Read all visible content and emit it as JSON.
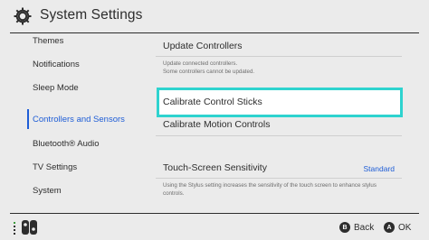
{
  "header": {
    "title": "System Settings",
    "icon": "gear-icon"
  },
  "sidebar": {
    "items": [
      {
        "label": "Themes"
      },
      {
        "label": "Notifications"
      },
      {
        "label": "Sleep Mode"
      },
      {
        "label": "Controllers and Sensors",
        "active": true
      },
      {
        "label": "Bluetooth® Audio"
      },
      {
        "label": "TV Settings"
      },
      {
        "label": "System"
      }
    ]
  },
  "main": {
    "rows": [
      {
        "title": "Update Controllers",
        "subtitle": "Update connected controllers.\nSome controllers cannot be updated."
      },
      {
        "title": "Calibrate Control Sticks",
        "selected": true
      },
      {
        "title": "Calibrate Motion Controls"
      },
      {
        "title": "Touch-Screen Sensitivity",
        "value": "Standard",
        "subtitle": "Using the Stylus setting increases the sensitivity of the touch screen to enhance stylus controls."
      }
    ]
  },
  "footer": {
    "controller_icon": "joycon-icon",
    "back_key": "B",
    "back_label": "Back",
    "ok_key": "A",
    "ok_label": "OK"
  },
  "colors": {
    "accent": "#1e5dd6",
    "selection": "#2ed3cf",
    "background": "#ebebeb"
  }
}
